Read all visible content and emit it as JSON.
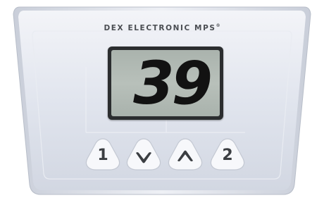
{
  "device": {
    "brand": "DEX ELECTRONIC MPS",
    "brand_mark": "®"
  },
  "display": {
    "value": "39"
  },
  "buttons": [
    {
      "id": "button-1",
      "label": "1"
    },
    {
      "id": "down-button",
      "icon": "chevron-down-icon"
    },
    {
      "id": "up-button",
      "icon": "chevron-up-icon"
    },
    {
      "id": "button-2",
      "label": "2"
    }
  ],
  "colors": {
    "faceplate": "#dfe3ec",
    "lcd_background": "#b0b8b2",
    "lcd_text": "#121212"
  }
}
